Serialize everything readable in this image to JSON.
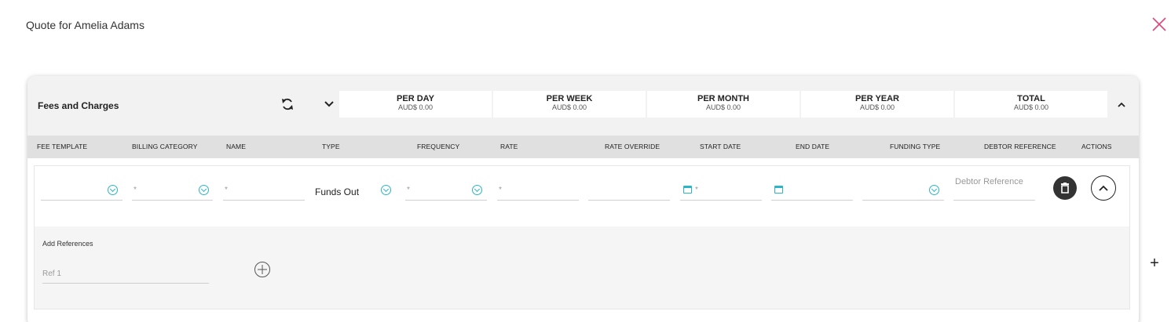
{
  "page": {
    "title": "Quote for Amelia Adams"
  },
  "section": {
    "title": "Fees and Charges",
    "summary": [
      {
        "label": "PER DAY",
        "value": "AUD$ 0.00"
      },
      {
        "label": "PER WEEK",
        "value": "AUD$ 0.00"
      },
      {
        "label": "PER MONTH",
        "value": "AUD$ 0.00"
      },
      {
        "label": "PER YEAR",
        "value": "AUD$ 0.00"
      },
      {
        "label": "TOTAL",
        "value": "AUD$ 0.00"
      }
    ]
  },
  "columns": [
    "FEE TEMPLATE",
    "BILLING CATEGORY",
    "NAME",
    "TYPE",
    "FREQUENCY",
    "RATE",
    "RATE OVERRIDE",
    "START DATE",
    "END DATE",
    "FUNDING TYPE",
    "DEBTOR REFERENCE",
    "ACTIONS"
  ],
  "row": {
    "fee_template": "",
    "billing_category_placeholder": "*",
    "name_placeholder": "*",
    "type_value": "Funds Out",
    "frequency_placeholder": "*",
    "rate_placeholder": "*",
    "rate_override": "",
    "start_date_placeholder": "*",
    "end_date": "",
    "funding_type": "",
    "debtor_reference_placeholder": "Debtor Reference"
  },
  "references": {
    "title": "Add References",
    "ref1_placeholder": "Ref 1"
  },
  "icons": {
    "close": "close-icon",
    "sync": "sync-icon",
    "expand": "chevron-down-icon",
    "collapse": "chevron-up-icon",
    "delete": "trash-icon",
    "add": "plus-circle-icon"
  },
  "colors": {
    "accent": "#2bb5c8",
    "close": "#e0457b",
    "header_bg": "#f2f2f2",
    "column_header_bg": "#e0e0e0"
  }
}
